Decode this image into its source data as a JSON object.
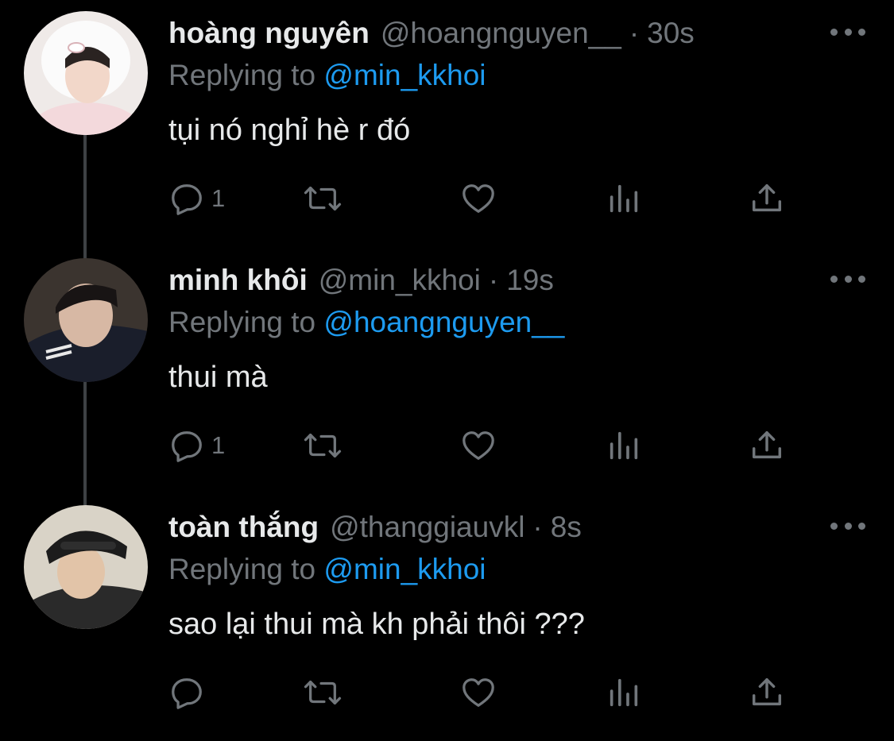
{
  "colors": {
    "background": "#000000",
    "primary_text": "#e7e9ea",
    "secondary_text": "#71767b",
    "mention": "#1d9bf0",
    "thread_line": "#3e4144"
  },
  "icons": {
    "more": "more-horizontal-icon",
    "reply": "reply-bubble-icon",
    "retweet": "retweet-arrows-icon",
    "like": "heart-outline-icon",
    "stats": "analytics-bars-icon",
    "share": "share-upload-icon"
  },
  "tweets": [
    {
      "display_name": "hoàng nguyên",
      "handle": "@hoangnguyen__",
      "separator": "·",
      "time": "30s",
      "replying_label": "Replying to",
      "replying_to": "@min_kkhoi",
      "text": "tụi nó nghỉ hè r đó",
      "reply_count": "1",
      "avatar": "avatar-photo"
    },
    {
      "display_name": "minh khôi",
      "handle": "@min_kkhoi",
      "separator": "·",
      "time": "19s",
      "replying_label": "Replying to",
      "replying_to": "@hoangnguyen__",
      "text": "thui mà",
      "reply_count": "1",
      "avatar": "avatar-photo"
    },
    {
      "display_name": "toàn thắng",
      "handle": "@thanggiauvkl",
      "separator": "·",
      "time": "8s",
      "replying_label": "Replying to",
      "replying_to": "@min_kkhoi",
      "text": "sao lại thui mà kh phải thôi ???",
      "reply_count": "",
      "avatar": "avatar-photo"
    }
  ]
}
